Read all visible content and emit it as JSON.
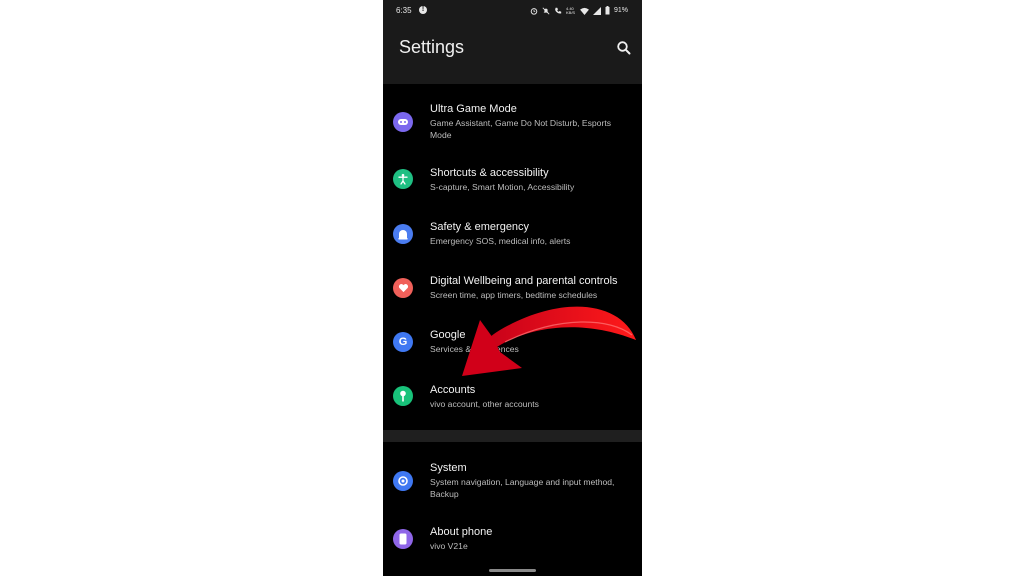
{
  "status_bar": {
    "time": "6:35",
    "notification_badge": "!",
    "icons": [
      "alarm-icon",
      "mute-icon",
      "call-icon",
      "data-speed-icon",
      "wifi-icon",
      "signal-icon",
      "battery-icon"
    ],
    "data_speed": "4.40 KB/S",
    "battery": "91%"
  },
  "header": {
    "title": "Settings",
    "search_icon": "search-icon"
  },
  "items": [
    {
      "label": "Ultra Game Mode",
      "sub": "Game Assistant, Game Do Not Disturb, Esports Mode",
      "icon": "gamepad-icon",
      "color": "#7b68ee"
    },
    {
      "label": "Shortcuts & accessibility",
      "sub": "S-capture, Smart Motion, Accessibility",
      "icon": "accessibility-icon",
      "color": "#1fbf83"
    },
    {
      "label": "Safety & emergency",
      "sub": "Emergency SOS, medical info, alerts",
      "icon": "shield-icon",
      "color": "#4a7cf0"
    },
    {
      "label": "Digital Wellbeing and parental controls",
      "sub": "Screen time, app timers, bedtime schedules",
      "icon": "heart-icon",
      "color": "#f0605a"
    },
    {
      "label": "Google",
      "sub": "Services & preferences",
      "icon": "google-icon",
      "color": "#3f78f2"
    },
    {
      "label": "Accounts",
      "sub": "vivo account, other accounts",
      "icon": "key-icon",
      "color": "#18c27a"
    },
    {
      "label": "System",
      "sub": "System navigation, Language and input method, Backup",
      "icon": "system-icon",
      "color": "#3f78f2"
    },
    {
      "label": "About phone",
      "sub": "vivo V21e",
      "icon": "phone-icon",
      "color": "#8f66e8"
    }
  ],
  "annotation": {
    "arrow_color": "#e0001b"
  }
}
